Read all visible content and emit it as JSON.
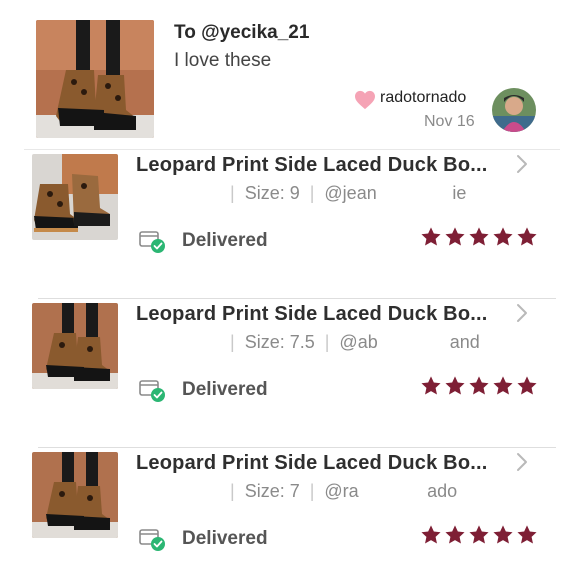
{
  "comment": {
    "to_label": "To @yecika_21",
    "text": "I love these",
    "username": "radotornado",
    "date": "Nov 16"
  },
  "orders": [
    {
      "title": "Leopard Print Side Laced Duck Bo...",
      "size": "Size: 9",
      "buyer": "@jean                     ie",
      "status": "Delivered",
      "rating": 5
    },
    {
      "title": "Leopard Print Side Laced Duck Bo...",
      "size": "Size: 7.5",
      "buyer": "@ab                    and",
      "status": "Delivered",
      "rating": 5
    },
    {
      "title": "Leopard Print Side Laced Duck Bo...",
      "size": "Size: 7",
      "buyer": "@ra                   ado",
      "status": "Delivered",
      "rating": 5
    }
  ],
  "colors": {
    "star": "#7e1f35",
    "heart": "#f5a3b5",
    "delivered_check": "#2bb673",
    "divider": "#dedede"
  },
  "icons": {
    "heart": "heart-icon",
    "chevron": "chevron-right-icon",
    "shipment": "package-delivered-icon",
    "star": "star-icon"
  }
}
